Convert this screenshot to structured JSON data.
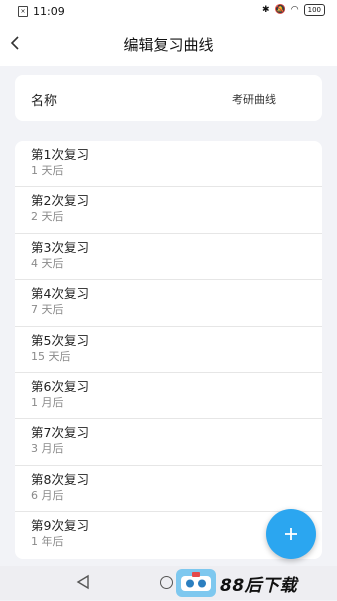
{
  "status_bar": {
    "time": "11:09",
    "battery": "100"
  },
  "header": {
    "title": "编辑复习曲线"
  },
  "name_field": {
    "label": "名称",
    "value": "考研曲线"
  },
  "reviews": [
    {
      "title": "第1次复习",
      "interval": "1 天后"
    },
    {
      "title": "第2次复习",
      "interval": "2 天后"
    },
    {
      "title": "第3次复习",
      "interval": "4 天后"
    },
    {
      "title": "第4次复习",
      "interval": "7 天后"
    },
    {
      "title": "第5次复习",
      "interval": "15 天后"
    },
    {
      "title": "第6次复习",
      "interval": "1 月后"
    },
    {
      "title": "第7次复习",
      "interval": "3 月后"
    },
    {
      "title": "第8次复习",
      "interval": "6 月后"
    },
    {
      "title": "第9次复习",
      "interval": "1 年后"
    }
  ],
  "fab": {
    "icon": "plus-icon",
    "color": "#2ba6f0"
  },
  "watermark": {
    "text": "88后下载"
  },
  "colors": {
    "background": "#f2f3f7",
    "accent": "#2ba6f0"
  }
}
